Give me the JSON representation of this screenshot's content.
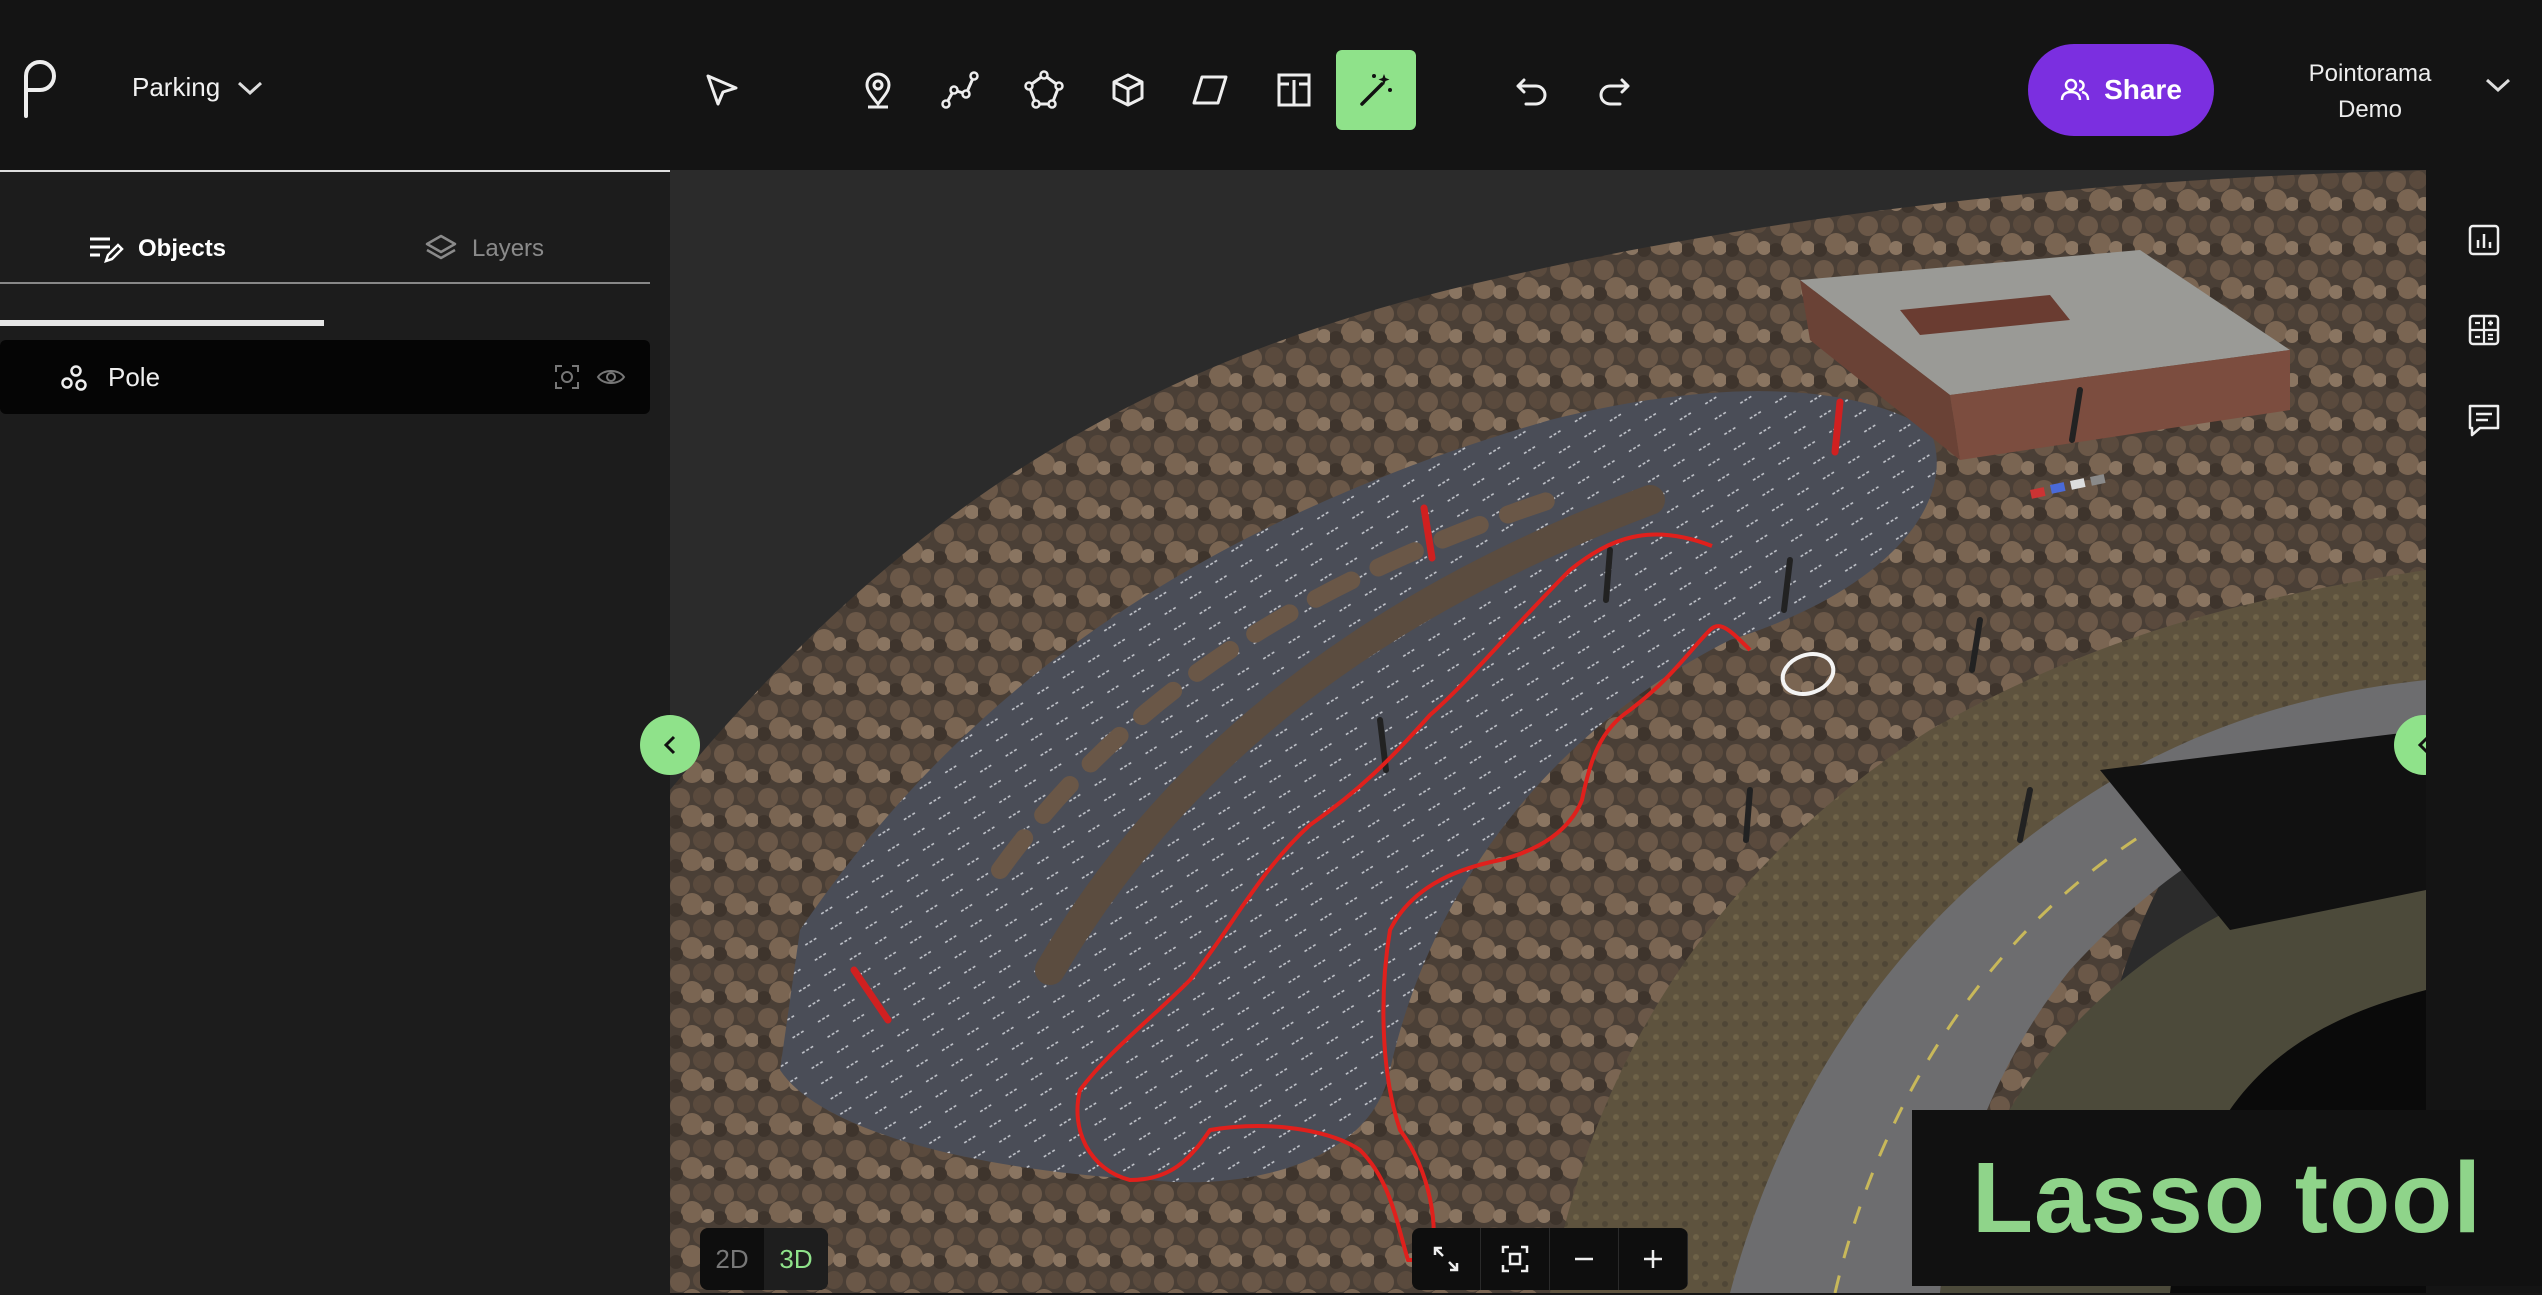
{
  "app": {
    "project_name": "Parking"
  },
  "toolbar": {
    "tools": [
      "select-tool",
      "point-tool",
      "polyline-tool",
      "polygon-tool",
      "box-tool",
      "plane-tool",
      "measure-tool",
      "magic-wand-tool"
    ],
    "active_tool": "magic-wand-tool",
    "share_label": "Share"
  },
  "user": {
    "line1": "Pointorama",
    "line2": "Demo"
  },
  "sidebar": {
    "tabs": [
      {
        "label": "Objects",
        "active": true
      },
      {
        "label": "Layers",
        "active": false
      }
    ],
    "objects": [
      {
        "label": "Pole",
        "icon": "object-group-icon"
      }
    ]
  },
  "viewport": {
    "mode_2d": "2D",
    "mode_3d": "3D",
    "active_mode": "3D"
  },
  "caption": "Lasso tool",
  "colors": {
    "accent": "#8fe28a",
    "share": "#7b2fe0",
    "lasso": "#e0201c"
  }
}
